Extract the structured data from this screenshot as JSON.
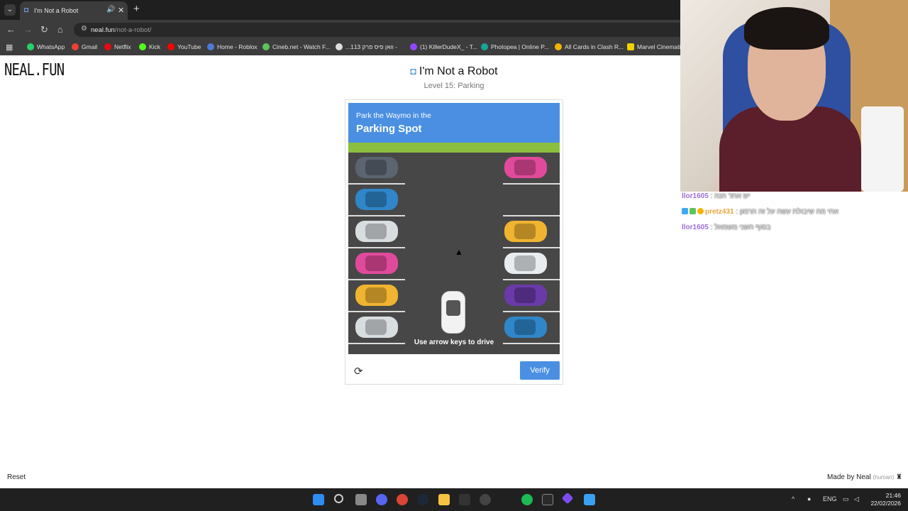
{
  "browser": {
    "tab_title": "I'm Not a Robot",
    "url_domain": "neal.fun",
    "url_path": "/not-a-robot/",
    "bookmarks": [
      {
        "label": "WhatsApp",
        "color": "#25d366"
      },
      {
        "label": "Gmail",
        "color": "#ea4335"
      },
      {
        "label": "Netflix",
        "color": "#e50914"
      },
      {
        "label": "Kick",
        "color": "#53fc18"
      },
      {
        "label": "YouTube",
        "color": "#ff0000"
      },
      {
        "label": "Home - Roblox",
        "color": "#4a7bd8"
      },
      {
        "label": "Cineb.net - Watch F...",
        "color": "#5cc45c"
      },
      {
        "label": "...וואן פיס פרק 113 -",
        "color": "#dddddd"
      },
      {
        "label": "(1) KillerDudeX_ - T...",
        "color": "#9146ff"
      },
      {
        "label": "Photopea | Online P...",
        "color": "#18a497"
      },
      {
        "label": "All Cards in Clash R...",
        "color": "#f5b300"
      },
      {
        "label": "Marvel Cinematic",
        "color": "#f0d000"
      }
    ]
  },
  "page": {
    "logo": "NEAL.FUN",
    "title": "I'm Not a Robot",
    "level": "Level 15: Parking",
    "banner_line1": "Park the Waymo in the",
    "banner_line2": "Parking Spot",
    "hint": "Use arrow keys to drive",
    "verify_label": "Verify",
    "reset_label": "Reset",
    "credit": "Made by Neal",
    "credit_human": "(human)"
  },
  "parking": {
    "left_cars": [
      "#5b6470",
      "#2f86c8",
      "#d8dde0",
      "#e04a9a",
      "#f0b430",
      "#d8dde0"
    ],
    "right_cars": [
      "#e04a9a",
      null,
      "#f0b430",
      "#e8ecef",
      "#6a3aa8",
      "#2f86c8"
    ]
  },
  "chat": [
    {
      "user": "llor1605",
      "text": "יש אחד הנה",
      "user_color": "#9b6fd8"
    },
    {
      "user": "pretz431",
      "text": "אחי מה שיבולת עשה על זה הרמון",
      "user_color": "#e8a53a"
    },
    {
      "user": "llor1605",
      "text": "בסוף השני משמאל",
      "user_color": "#9b6fd8"
    }
  ],
  "taskbar": {
    "language": "ENG",
    "time": "21:46",
    "date": "22/02/2026"
  }
}
